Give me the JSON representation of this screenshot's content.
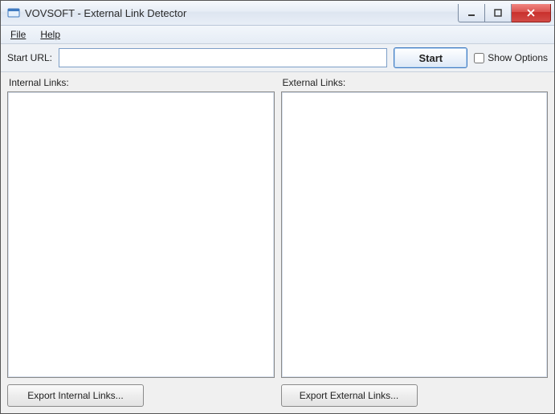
{
  "title": "VOVSOFT - External Link Detector",
  "menu": {
    "file": "File",
    "help": "Help"
  },
  "toolbar": {
    "start_url_label": "Start URL:",
    "url_value": "",
    "start_button": "Start",
    "show_options": "Show Options",
    "show_options_checked": false
  },
  "panels": {
    "internal": {
      "label": "Internal Links:",
      "export": "Export Internal Links..."
    },
    "external": {
      "label": "External Links:",
      "export": "Export External Links..."
    }
  }
}
